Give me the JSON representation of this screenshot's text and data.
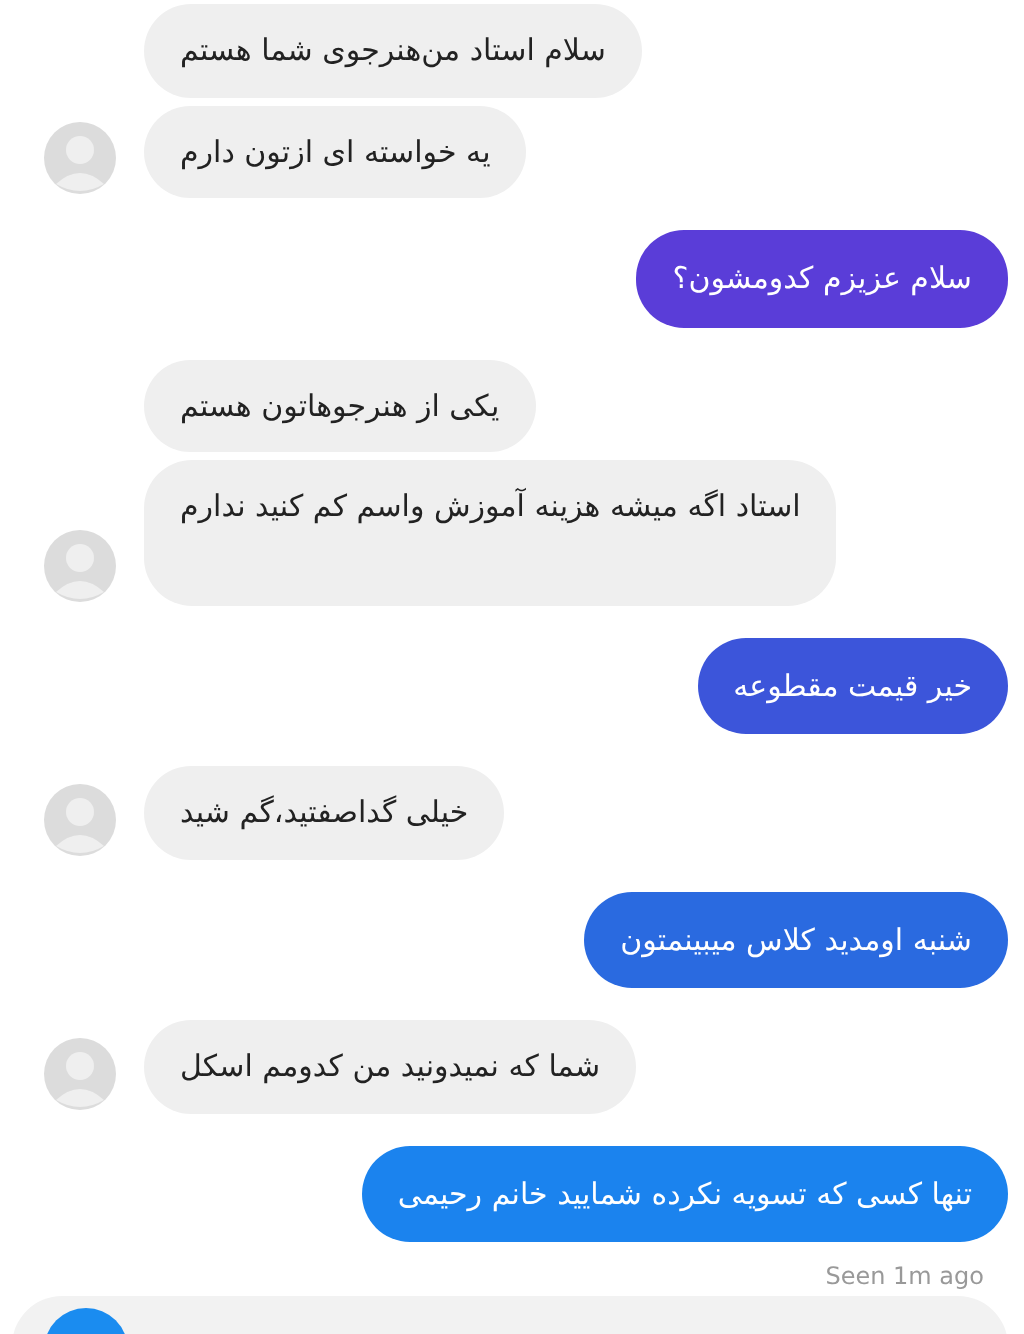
{
  "messages": [
    {
      "kind": "incoming",
      "text": "سلام استاد من‌هنرجوی شما هستم",
      "avatar": false
    },
    {
      "kind": "incoming",
      "text": "یه خواسته ای ازتون دارم",
      "avatar": true
    },
    {
      "kind": "outgoing",
      "text": "سلام عزیزم کدومشون؟",
      "color": "#5a3dd8"
    },
    {
      "kind": "incoming",
      "text": "یکی از هنرجوهاتون هستم",
      "avatar": false
    },
    {
      "kind": "incoming",
      "text": "استاد اگه میشه هزینه آموزش واسم کم کنید ندارم",
      "avatar": true
    },
    {
      "kind": "outgoing",
      "text": "خیر قیمت مقطوعه",
      "color": "#3c55da"
    },
    {
      "kind": "incoming",
      "text": "خیلی گداصفتید،گم شید",
      "avatar": true
    },
    {
      "kind": "outgoing",
      "text": "شنبه اومدید کلاس میبینمتون",
      "color": "#2a6ae0"
    },
    {
      "kind": "incoming",
      "text": "شما که نمیدونید من کدومم اسکل",
      "avatar": true
    },
    {
      "kind": "outgoing",
      "text": "تنها کسی که تسویه نکرده شمایید خانم رحیمی",
      "color": "#1b83ee"
    }
  ],
  "seen": "Seen 1m ago"
}
